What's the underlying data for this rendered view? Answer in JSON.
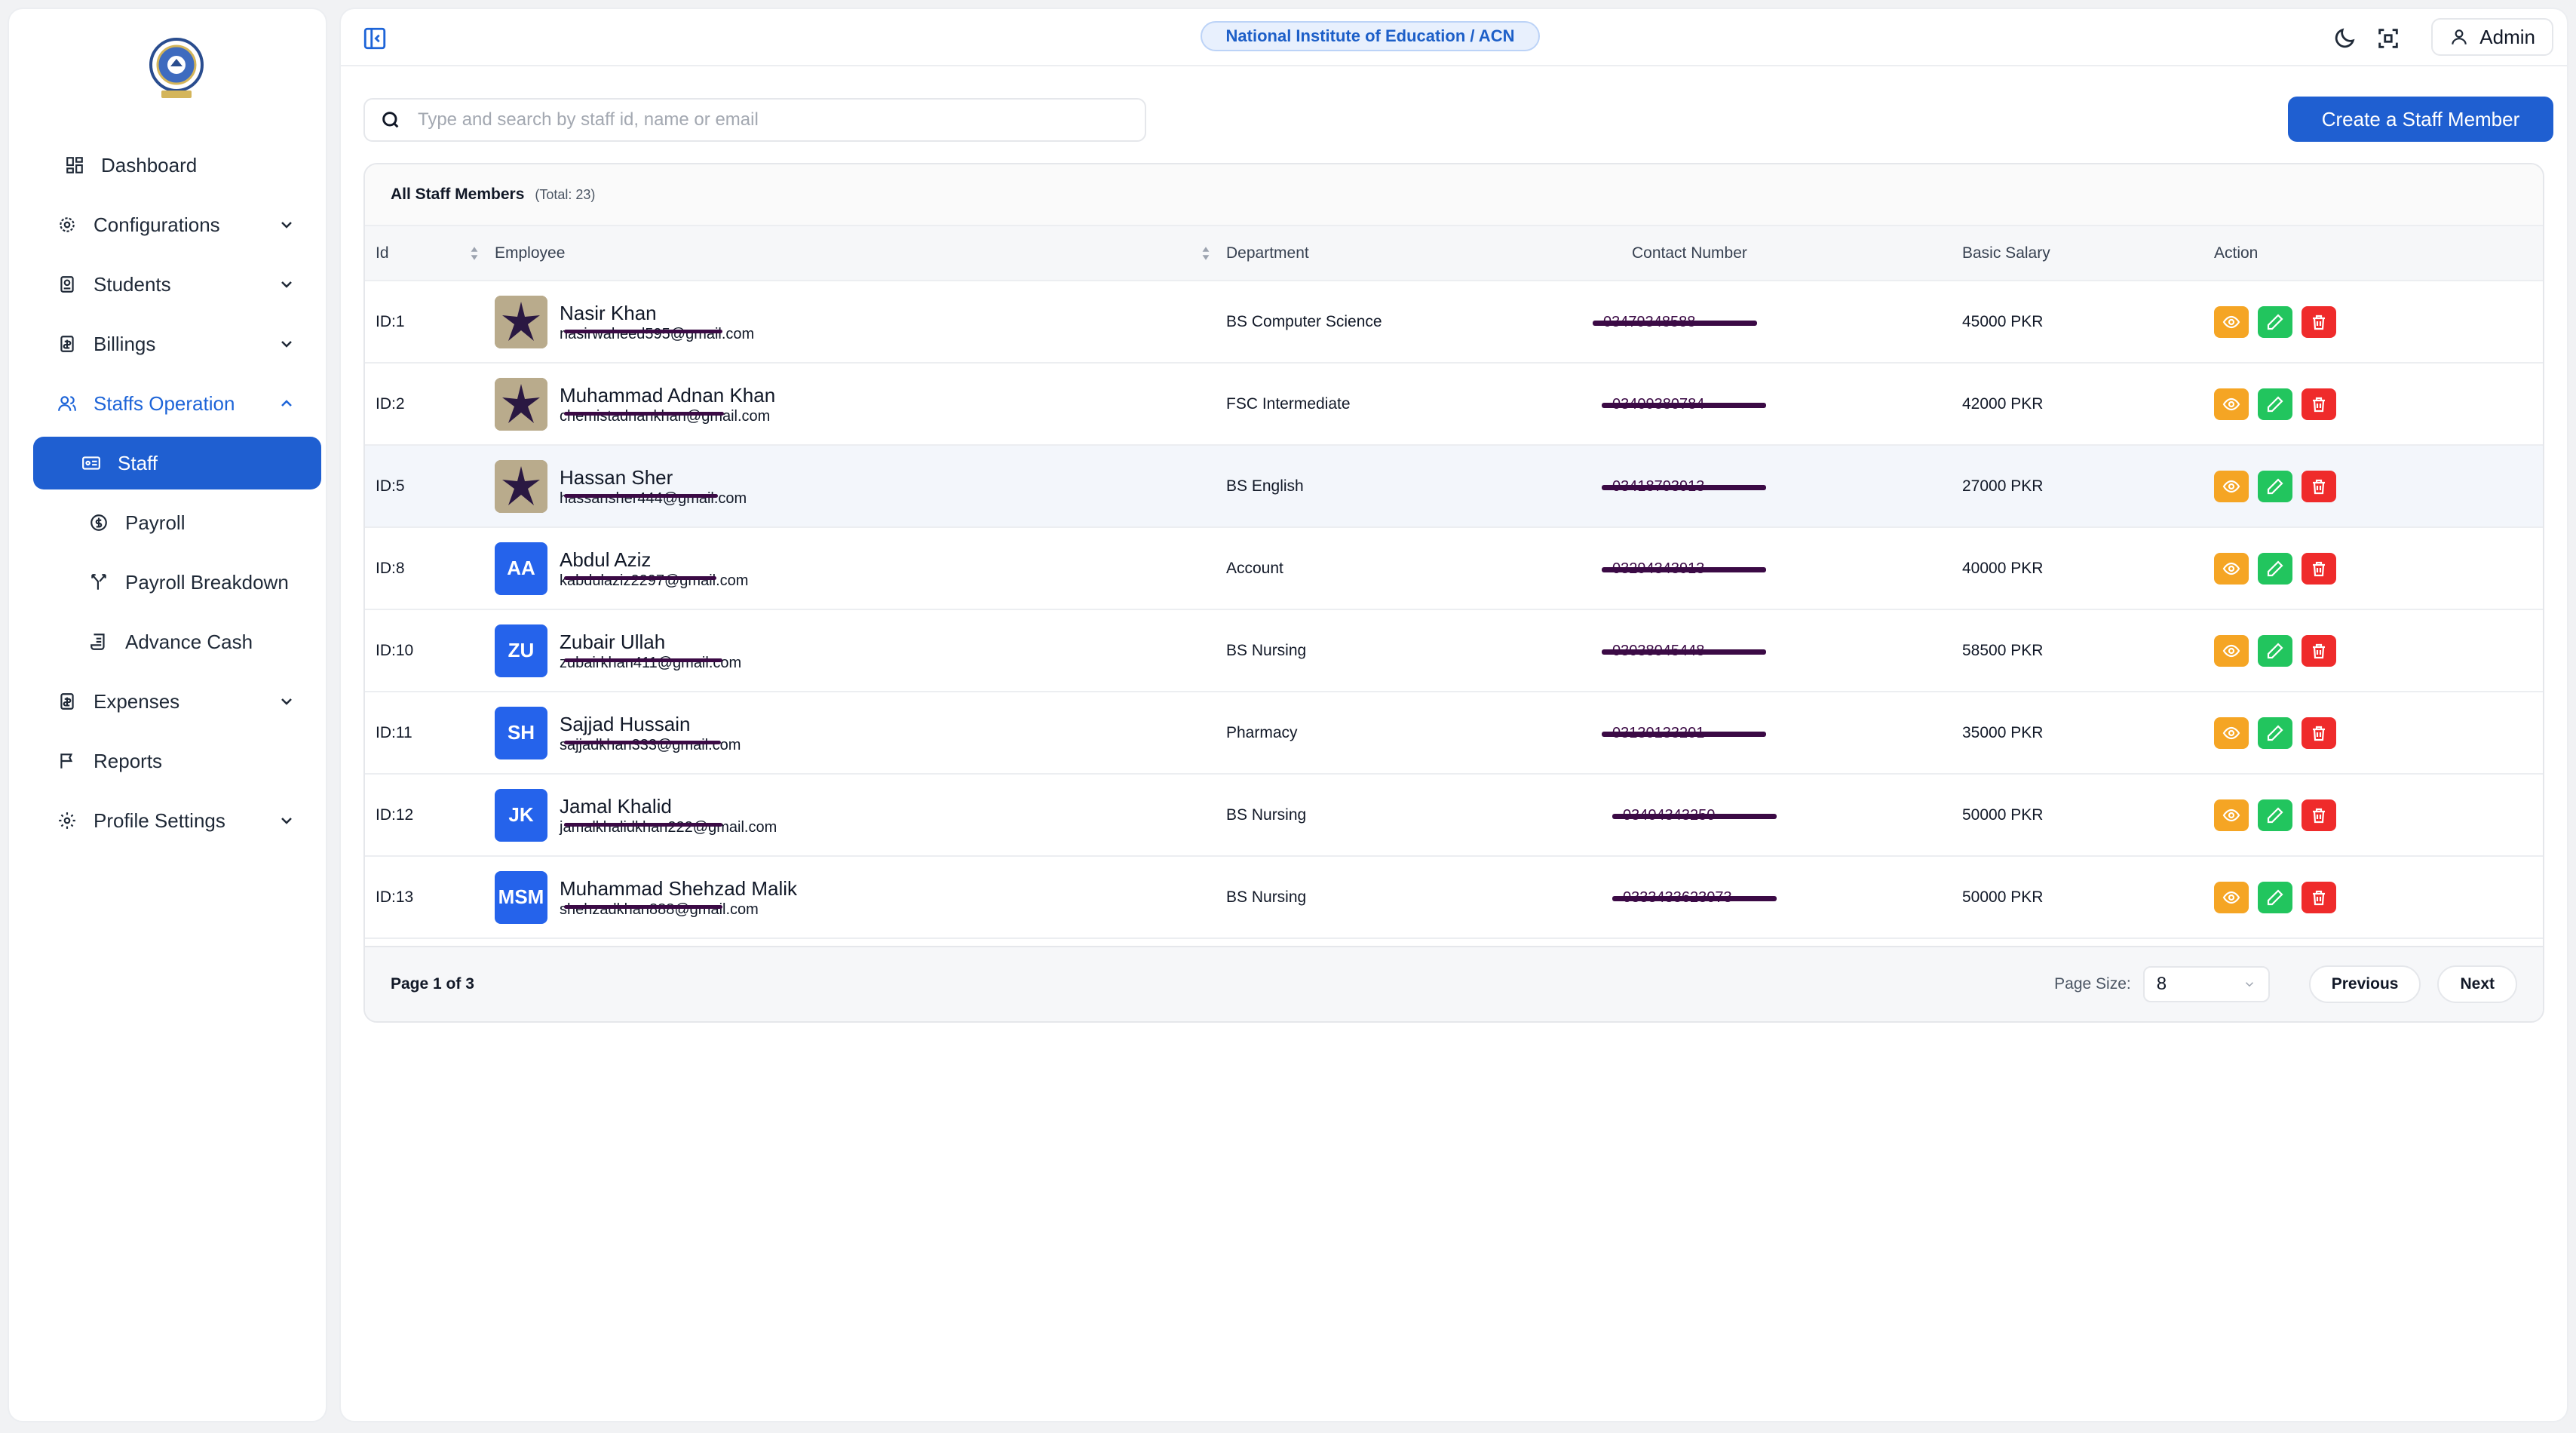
{
  "header": {
    "institute": "National Institute of Education / ACN",
    "user_label": "Admin"
  },
  "sidebar": {
    "items": [
      {
        "label": "Dashboard",
        "icon": "dashboard-icon"
      },
      {
        "label": "Configurations",
        "icon": "gear-icon"
      },
      {
        "label": "Students",
        "icon": "student-icon"
      },
      {
        "label": "Billings",
        "icon": "billing-icon"
      },
      {
        "label": "Staffs Operation",
        "icon": "users-icon"
      },
      {
        "label": "Staff",
        "icon": "id-card-icon"
      },
      {
        "label": "Payroll",
        "icon": "dollar-circle-icon"
      },
      {
        "label": "Payroll Breakdown",
        "icon": "split-icon"
      },
      {
        "label": "Advance Cash",
        "icon": "scroll-icon"
      },
      {
        "label": "Expenses",
        "icon": "receipt-icon"
      },
      {
        "label": "Reports",
        "icon": "flag-icon"
      },
      {
        "label": "Profile Settings",
        "icon": "settings-icon"
      }
    ]
  },
  "search": {
    "placeholder": "Type and search by staff id, name or email",
    "value": ""
  },
  "create_button": "Create a Staff Member",
  "table": {
    "title": "All Staff Members",
    "total": "(Total: 23)",
    "columns": [
      "Id",
      "Employee",
      "Department",
      "Contact Number",
      "Basic Salary",
      "Action"
    ],
    "rows": [
      {
        "id": "ID:1",
        "name": "Nasir Khan",
        "email": "nasirwaheed595@gmail.com",
        "dept": "BS Computer Science",
        "contact": "03479348588",
        "salary": "45000 PKR",
        "initials": ""
      },
      {
        "id": "ID:2",
        "name": "Muhammad Adnan Khan",
        "email": "chemistadnankhan@gmail.com",
        "dept": "FSC Intermediate",
        "contact": "03409380784",
        "salary": "42000 PKR",
        "initials": ""
      },
      {
        "id": "ID:5",
        "name": "Hassan Sher",
        "email": "hassansher444@gmail.com",
        "dept": "BS English",
        "contact": "03418793913",
        "salary": "27000 PKR",
        "initials": ""
      },
      {
        "id": "ID:8",
        "name": "Abdul Aziz",
        "email": "kabdulaziz2297@gmail.com",
        "dept": "Account",
        "contact": "03294343913",
        "salary": "40000 PKR",
        "initials": "AA"
      },
      {
        "id": "ID:10",
        "name": "Zubair Ullah",
        "email": "zubairkhan411@gmail.com",
        "dept": "BS Nursing",
        "contact": "03038045448",
        "salary": "58500 PKR",
        "initials": "ZU"
      },
      {
        "id": "ID:11",
        "name": "Sajjad Hussain",
        "email": "sajjadkhan333@gmail.com",
        "dept": "Pharmacy",
        "contact": "03130133201",
        "salary": "35000 PKR",
        "initials": "SH"
      },
      {
        "id": "ID:12",
        "name": "Jamal Khalid",
        "email": "jamalkhalidkhan222@gmail.com",
        "dept": "BS Nursing",
        "contact": "03404343250",
        "salary": "50000 PKR",
        "initials": "JK"
      },
      {
        "id": "ID:13",
        "name": "Muhammad Shehzad Malik",
        "email": "shehzadkhan888@gmail.com",
        "dept": "BS Nursing",
        "contact": "0333433623073",
        "salary": "50000 PKR",
        "initials": "MSM"
      }
    ]
  },
  "pagination": {
    "page_info": "Page 1 of 3",
    "page_size_label": "Page Size:",
    "page_size": "8",
    "previous": "Previous",
    "next": "Next"
  },
  "colors": {
    "primary": "#1f5fd1",
    "view_action": "#f5a524",
    "edit_action": "#22c55e",
    "delete_action": "#ef2b2b"
  }
}
